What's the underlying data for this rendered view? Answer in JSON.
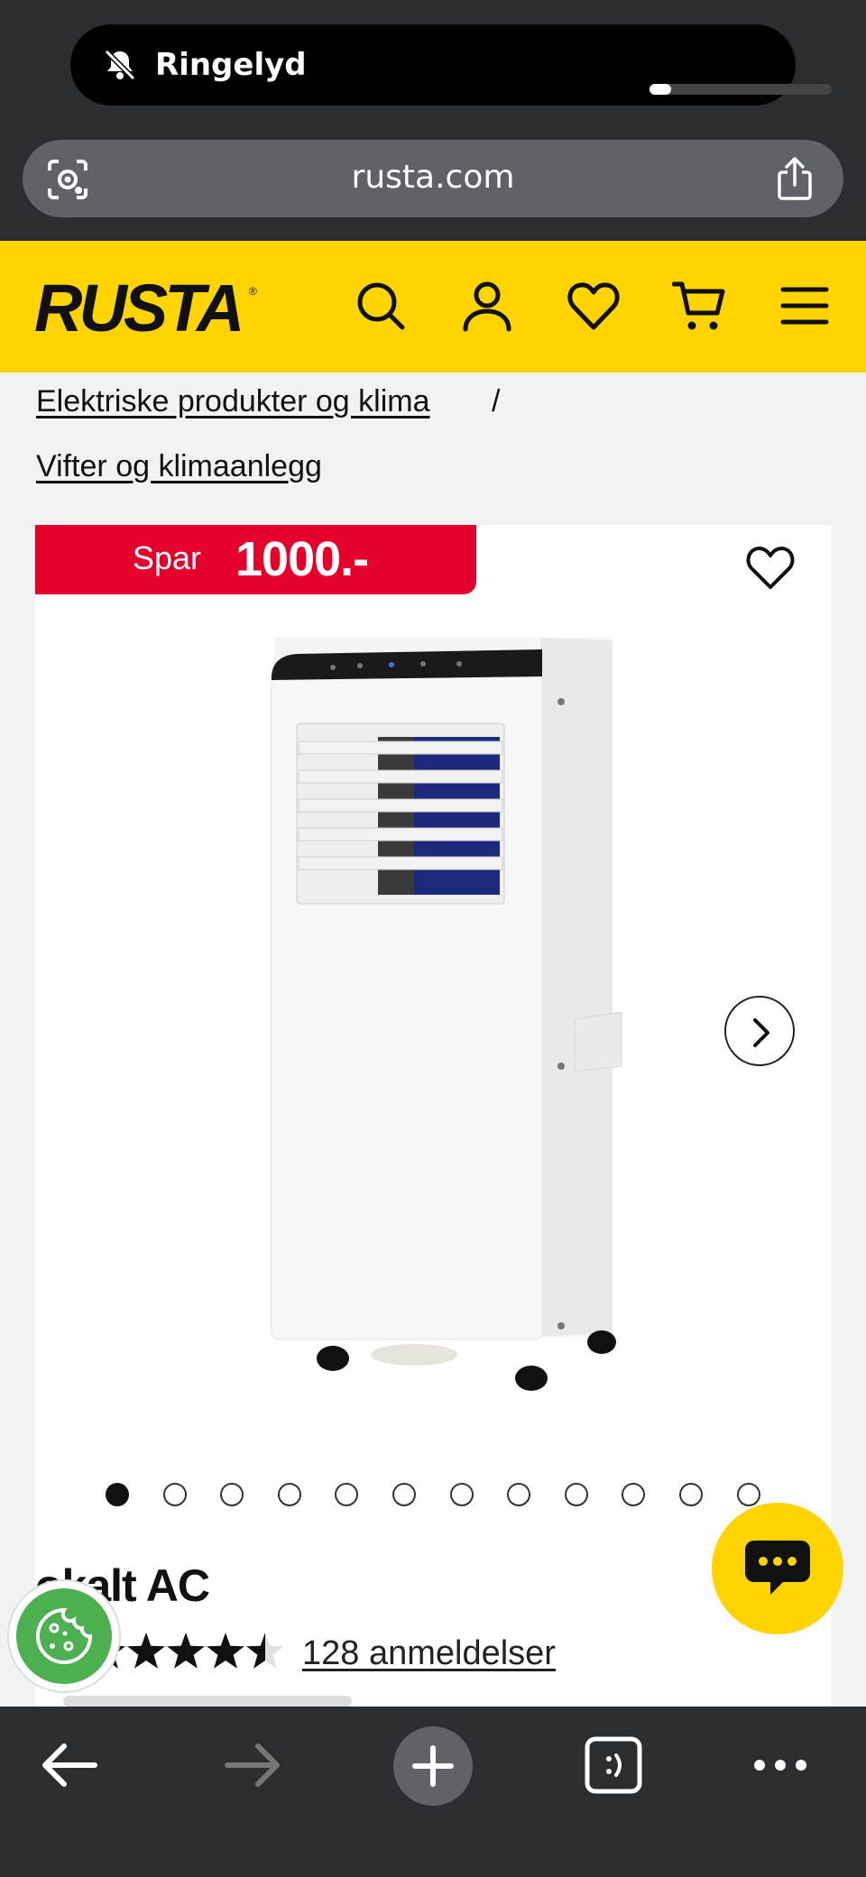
{
  "status": {
    "notification_label": "Ringelyd",
    "volume_level": 0.12
  },
  "browser": {
    "url": "rusta.com",
    "lens_icon": "camera-search-icon",
    "share_icon": "share-icon"
  },
  "header": {
    "logo_text": "RUSTA",
    "brand_color": "#ffd400",
    "icons": [
      "search-icon",
      "account-icon",
      "heart-icon",
      "cart-icon",
      "menu-icon"
    ]
  },
  "breadcrumbs": {
    "items": [
      "Elektriske produkter og klima",
      "Vifter og klimaanlegg"
    ],
    "separator": "/"
  },
  "product": {
    "save_label": "Spar",
    "save_amount": "1000.-",
    "badge_color": "#e4002b",
    "title": "okalt AC",
    "rating": 4.5,
    "rating_max": 5,
    "reviews_text": "128 anmeldelser",
    "gallery_count": 12,
    "gallery_active_index": 0
  },
  "widgets": {
    "chat_icon": "chat-bubble-icon",
    "cookie_icon": "cookie-icon"
  },
  "toolbar": {
    "icons": [
      "back-icon",
      "forward-icon",
      "new-tab-icon",
      "tabs-icon",
      "more-icon"
    ]
  }
}
